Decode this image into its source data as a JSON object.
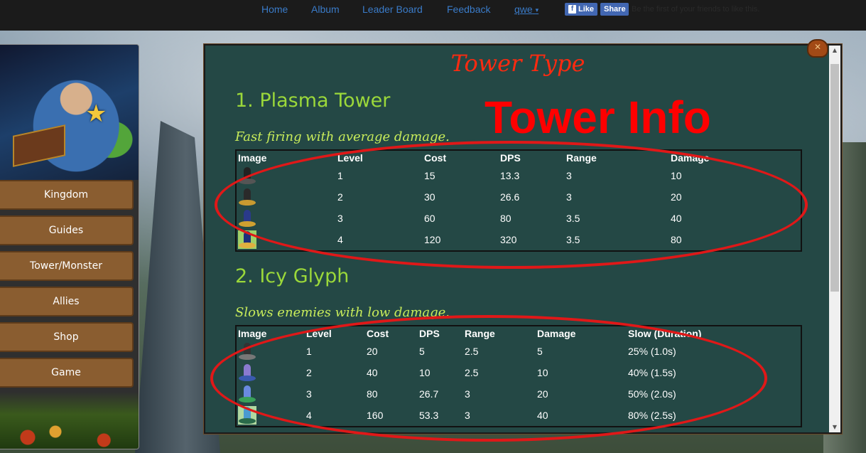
{
  "nav": {
    "links": [
      {
        "label": "Home"
      },
      {
        "label": "Album"
      },
      {
        "label": "Leader Board"
      },
      {
        "label": "Feedback"
      }
    ],
    "user": "qwe",
    "fb_like": "Like",
    "fb_share": "Share",
    "fb_text": "Be the first of your friends to like this."
  },
  "sidebar": {
    "items": [
      "Kingdom",
      "Guides",
      "Tower/Monster",
      "Allies",
      "Shop",
      "Game"
    ]
  },
  "panel": {
    "title": "Tower Type",
    "overlay": "Tower Info"
  },
  "sections": [
    {
      "title": "1. Plasma Tower",
      "desc": "Fast firing with average damage.",
      "headers": [
        "Image",
        "Level",
        "Cost",
        "DPS",
        "Range",
        "Damage"
      ],
      "rows": [
        [
          "1",
          "15",
          "13.3",
          "3",
          "10"
        ],
        [
          "2",
          "30",
          "26.6",
          "3",
          "20"
        ],
        [
          "3",
          "60",
          "80",
          "3.5",
          "40"
        ],
        [
          "4",
          "120",
          "320",
          "3.5",
          "80"
        ]
      ]
    },
    {
      "title": "2. Icy Glyph",
      "desc": "Slows enemies with low damage.",
      "headers": [
        "Image",
        "Level",
        "Cost",
        "DPS",
        "Range",
        "Damage",
        "Slow (Duration)"
      ],
      "rows": [
        [
          "1",
          "20",
          "5",
          "2.5",
          "5",
          "25% (1.0s)"
        ],
        [
          "2",
          "40",
          "10",
          "2.5",
          "10",
          "40% (1.5s)"
        ],
        [
          "3",
          "80",
          "26.7",
          "3",
          "20",
          "50% (2.0s)"
        ],
        [
          "4",
          "160",
          "53.3",
          "3",
          "40",
          "80% (2.5s)"
        ]
      ]
    }
  ],
  "colors": {
    "panel_bg": "#244845",
    "title_red": "#ff2a10",
    "section_green": "#9bd83a",
    "menu_brown": "#8a5d30",
    "nav_blue": "#3a7bc8",
    "facebook_blue": "#4267b2"
  },
  "icons": [
    "star-icon",
    "close-icon",
    "facebook-icon",
    "caret-down-icon",
    "tower-icon",
    "scroll-up-icon",
    "scroll-down-icon"
  ]
}
